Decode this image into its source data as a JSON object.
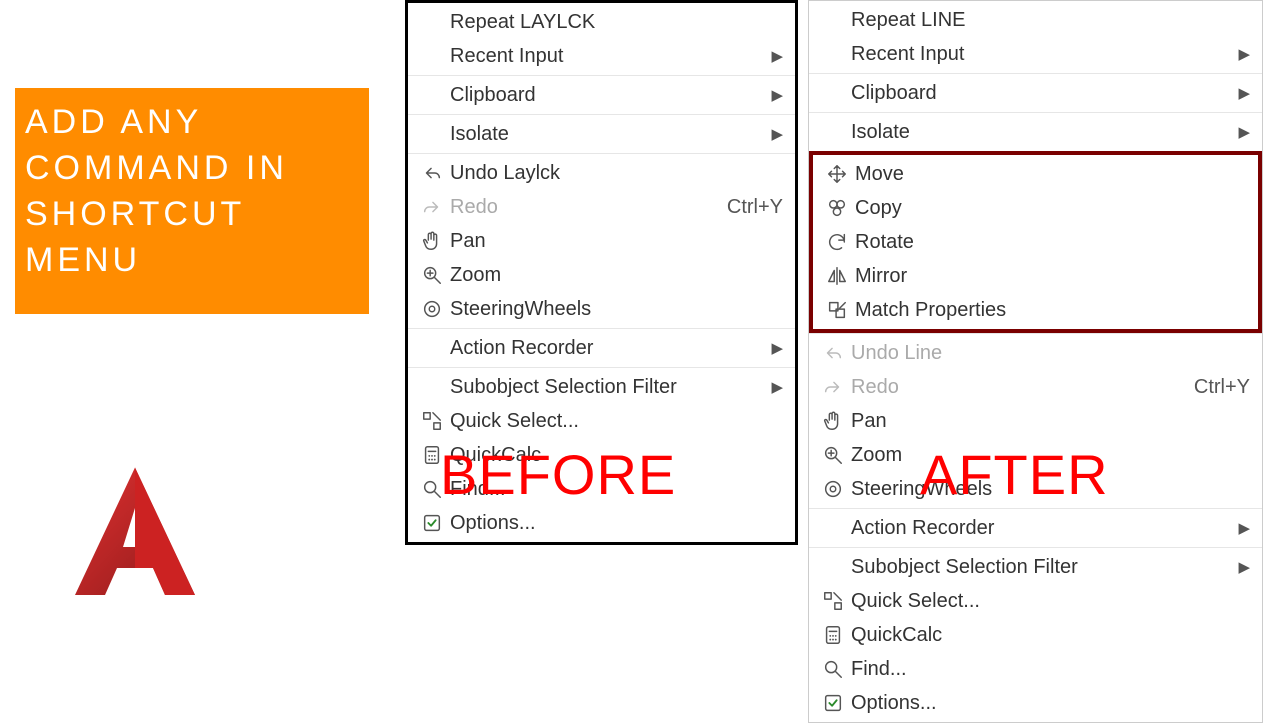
{
  "title_box": "ADD ANY COMMAND IN SHORTCUT MENU",
  "labels": {
    "before": "BEFORE",
    "after": "AFTER"
  },
  "menu_before": {
    "groups": [
      {
        "items": [
          {
            "label": "Repeat LAYLCK",
            "icon": ""
          },
          {
            "label": "Recent Input",
            "icon": "",
            "sub": true
          }
        ]
      },
      {
        "items": [
          {
            "label": "Clipboard",
            "icon": "",
            "sub": true
          }
        ]
      },
      {
        "items": [
          {
            "label": "Isolate",
            "icon": "",
            "sub": true
          }
        ]
      },
      {
        "items": [
          {
            "label": "Undo Laylck",
            "icon": "undo"
          },
          {
            "label": "Redo",
            "icon": "redo",
            "disabled": true,
            "shortcut": "Ctrl+Y"
          },
          {
            "label": "Pan",
            "icon": "hand"
          },
          {
            "label": "Zoom",
            "icon": "zoom"
          },
          {
            "label": "SteeringWheels",
            "icon": "wheel"
          }
        ]
      },
      {
        "items": [
          {
            "label": "Action Recorder",
            "icon": "",
            "sub": true
          }
        ]
      },
      {
        "items": [
          {
            "label": "Subobject Selection Filter",
            "icon": "",
            "sub": true
          },
          {
            "label": "Quick Select...",
            "icon": "quicksel"
          },
          {
            "label": "QuickCalc",
            "icon": "calc"
          },
          {
            "label": "Find...",
            "icon": "find"
          },
          {
            "label": "Options...",
            "icon": "check"
          }
        ]
      }
    ]
  },
  "menu_after": {
    "groups": [
      {
        "items": [
          {
            "label": "Repeat LINE",
            "icon": ""
          },
          {
            "label": "Recent Input",
            "icon": "",
            "sub": true
          }
        ]
      },
      {
        "items": [
          {
            "label": "Clipboard",
            "icon": "",
            "sub": true
          }
        ]
      },
      {
        "items": [
          {
            "label": "Isolate",
            "icon": "",
            "sub": true
          }
        ]
      },
      {
        "highlight": true,
        "items": [
          {
            "label": "Move",
            "icon": "move"
          },
          {
            "label": "Copy",
            "icon": "copy"
          },
          {
            "label": "Rotate",
            "icon": "rotate"
          },
          {
            "label": "Mirror",
            "icon": "mirror"
          },
          {
            "label": "Match Properties",
            "icon": "match"
          }
        ]
      },
      {
        "items": [
          {
            "label": "Undo Line",
            "icon": "undo",
            "disabled": true
          },
          {
            "label": "Redo",
            "icon": "redo",
            "disabled": true,
            "shortcut": "Ctrl+Y"
          },
          {
            "label": "Pan",
            "icon": "hand"
          },
          {
            "label": "Zoom",
            "icon": "zoom"
          },
          {
            "label": "SteeringWheels",
            "icon": "wheel"
          }
        ]
      },
      {
        "items": [
          {
            "label": "Action Recorder",
            "icon": "",
            "sub": true
          }
        ]
      },
      {
        "items": [
          {
            "label": "Subobject Selection Filter",
            "icon": "",
            "sub": true
          },
          {
            "label": "Quick Select...",
            "icon": "quicksel"
          },
          {
            "label": "QuickCalc",
            "icon": "calc"
          },
          {
            "label": "Find...",
            "icon": "find"
          },
          {
            "label": "Options...",
            "icon": "check"
          }
        ]
      }
    ]
  }
}
